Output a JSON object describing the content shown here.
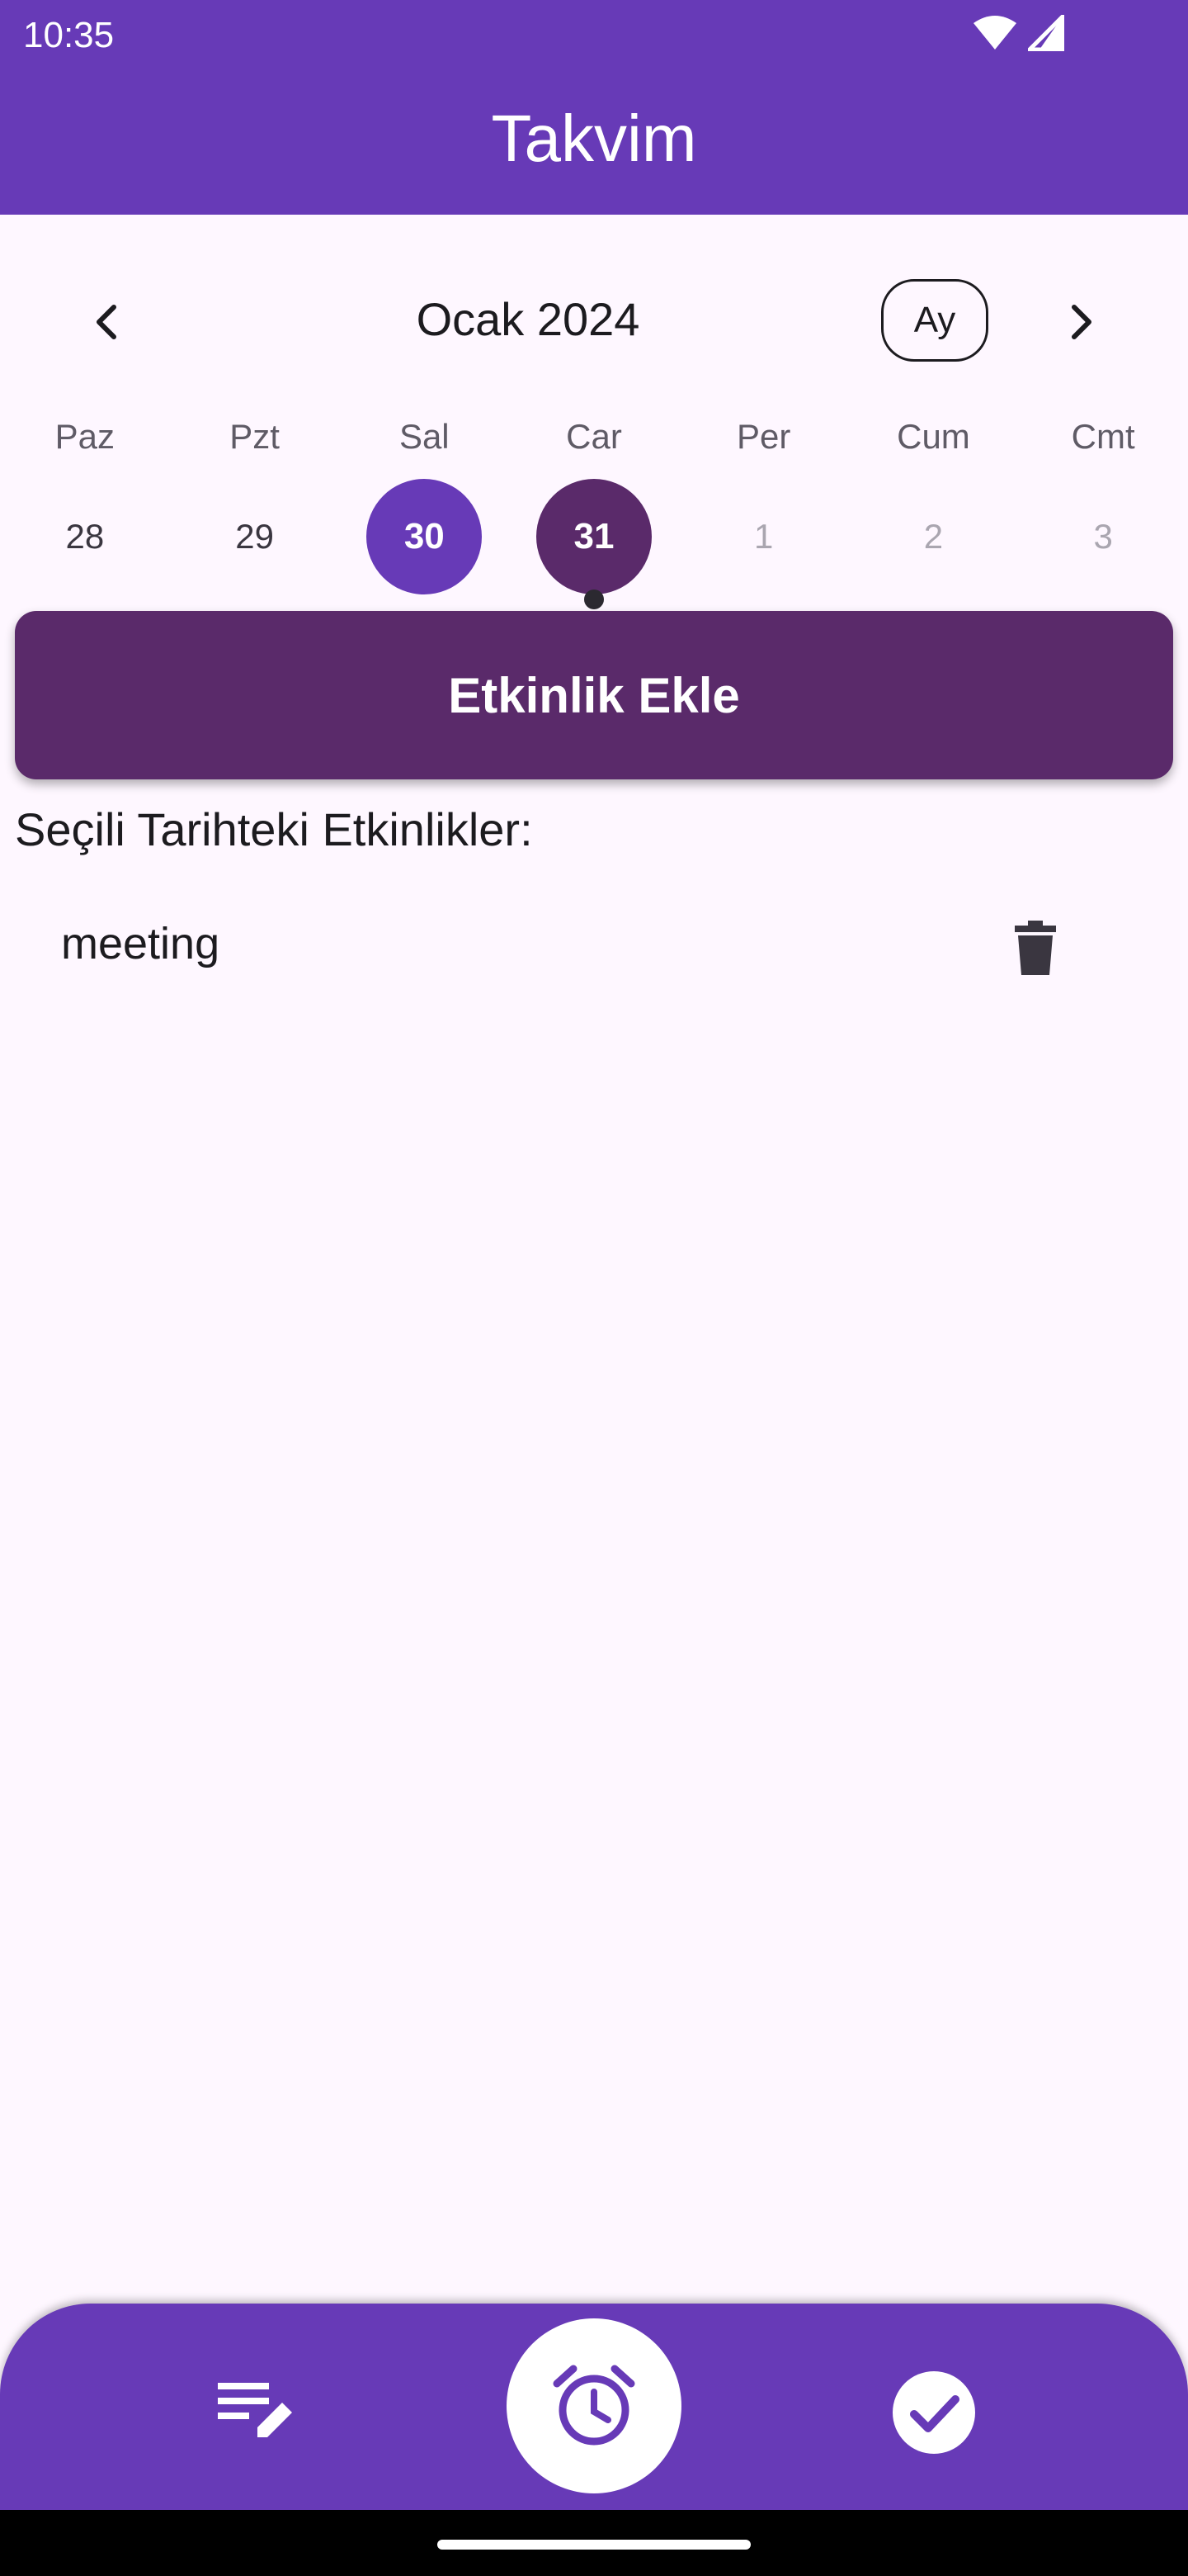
{
  "status_bar": {
    "time": "10:35",
    "icons": [
      "wifi-icon",
      "signal-icon"
    ]
  },
  "app_bar": {
    "title": "Takvim"
  },
  "calendar": {
    "month_label": "Ocak 2024",
    "format_button": "Ay",
    "weekdays": [
      "Paz",
      "Pzt",
      "Sal",
      "Car",
      "Per",
      "Cum",
      "Cmt"
    ],
    "days": [
      {
        "label": "28",
        "state": "normal"
      },
      {
        "label": "29",
        "state": "normal"
      },
      {
        "label": "30",
        "state": "today"
      },
      {
        "label": "31",
        "state": "selected",
        "has_event": true
      },
      {
        "label": "1",
        "state": "outside"
      },
      {
        "label": "2",
        "state": "outside"
      },
      {
        "label": "3",
        "state": "outside"
      }
    ]
  },
  "actions": {
    "add_event_label": "Etkinlik Ekle"
  },
  "events": {
    "heading": "Seçili Tarihteki Etkinlikler:",
    "items": [
      {
        "title": "meeting"
      }
    ]
  },
  "bottom_nav": {
    "items": [
      "notes-icon",
      "alarm-icon",
      "check-icon"
    ]
  },
  "colors": {
    "primary": "#673ab7",
    "selected_day": "#5a2a6a",
    "background": "#fef7ff"
  }
}
